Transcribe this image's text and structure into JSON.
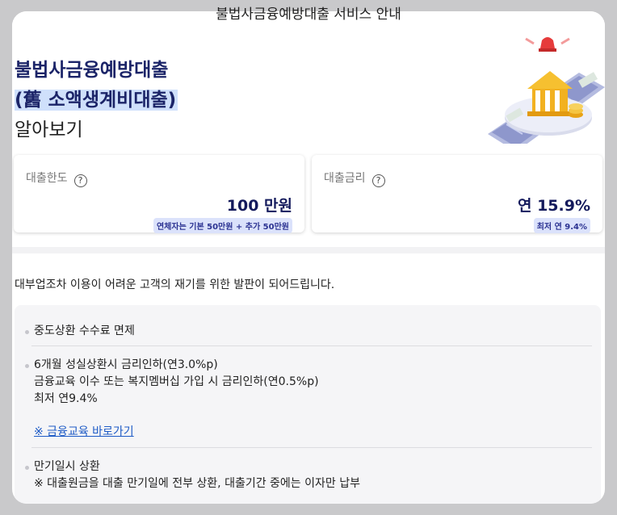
{
  "modal": {
    "title": "불법사금융예방대출 서비스 안내"
  },
  "hero": {
    "title_line1": "불법사금융예방대출",
    "title_line2": "(舊 소액생계비대출)",
    "title_line3": "알아보기"
  },
  "cards": [
    {
      "label": "대출한도",
      "help": "?",
      "value": "100 만원",
      "badge": "연체자는 기본 50만원 + 추가 50만원"
    },
    {
      "label": "대출금리",
      "help": "?",
      "value": "연 15.9%",
      "badge": "최저 연 9.4%"
    }
  ],
  "description": "대부업조차 이용이 어려운 고객의 재기를 위한 발판이 되어드립니다.",
  "info": {
    "item1": "중도상환 수수료 면제",
    "item2_line1": "6개월 성실상환시 금리인하(연3.0%p)",
    "item2_line2": "금융교육 이수 또는 복지멤버십 가입 시 금리인하(연0.5%p)",
    "item2_line3": "최저 연9.4%",
    "item2_link": "※ 금융교육 바로가기",
    "item3_line1": "만기일시 상환",
    "item3_line2": "※ 대출원금을 대출 만기일에 전부 상환, 대출기간 중에는 이자만 납부"
  },
  "colors": {
    "accent_navy": "#141a5c",
    "badge_bg": "#dbe2fb",
    "link": "#1e5bc6",
    "highlight": "#cfe0fb"
  },
  "icons": {
    "help": "question-circle-icon",
    "illustration": "bank-building-illustration"
  }
}
